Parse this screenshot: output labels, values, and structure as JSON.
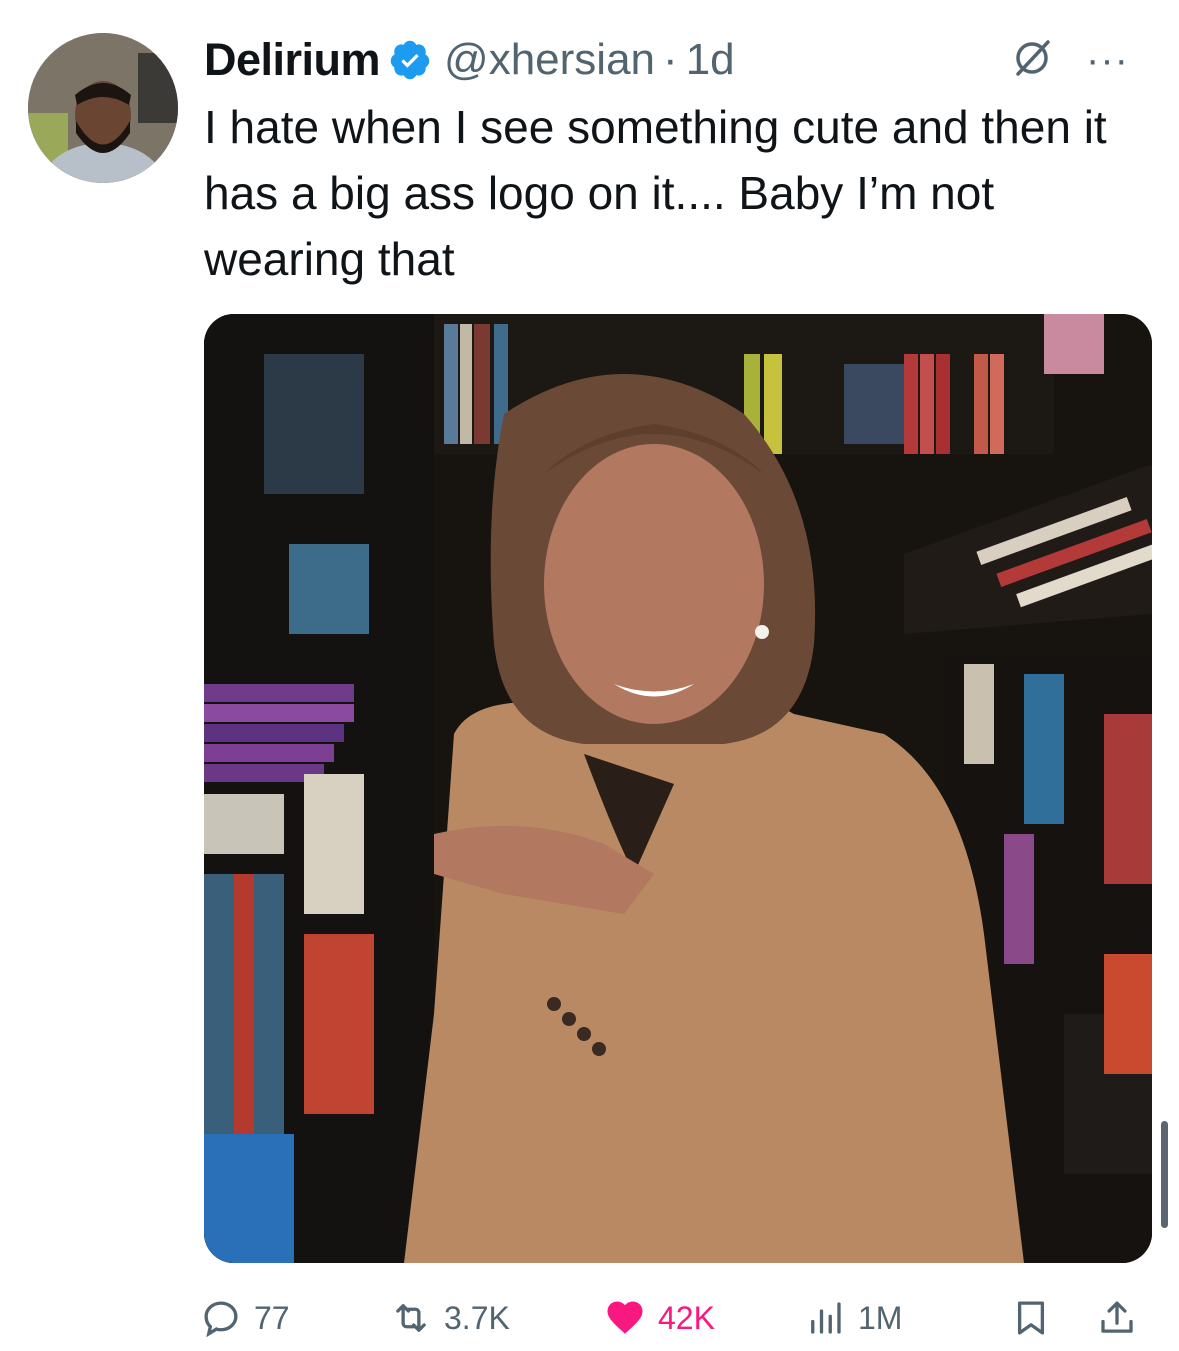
{
  "author": {
    "name": "Delirium",
    "handle": "@xhersian",
    "separator": "·",
    "time": "1d",
    "verified": true,
    "avatar_icon": "profile-photo"
  },
  "tweet": {
    "text": "I hate when I see something cute and then it has a big ass logo on it.... Baby I’m not wearing that",
    "media_icon": "photo"
  },
  "header_icons": {
    "grok": "grok-icon",
    "more": "···"
  },
  "metrics": {
    "replies": "77",
    "reposts": "3.7K",
    "likes": "42K",
    "views": "1M",
    "liked": true
  },
  "colors": {
    "like": "#f91880",
    "verified": "#1d9bf0",
    "secondary_text": "#536471",
    "primary_text": "#0f1419"
  }
}
